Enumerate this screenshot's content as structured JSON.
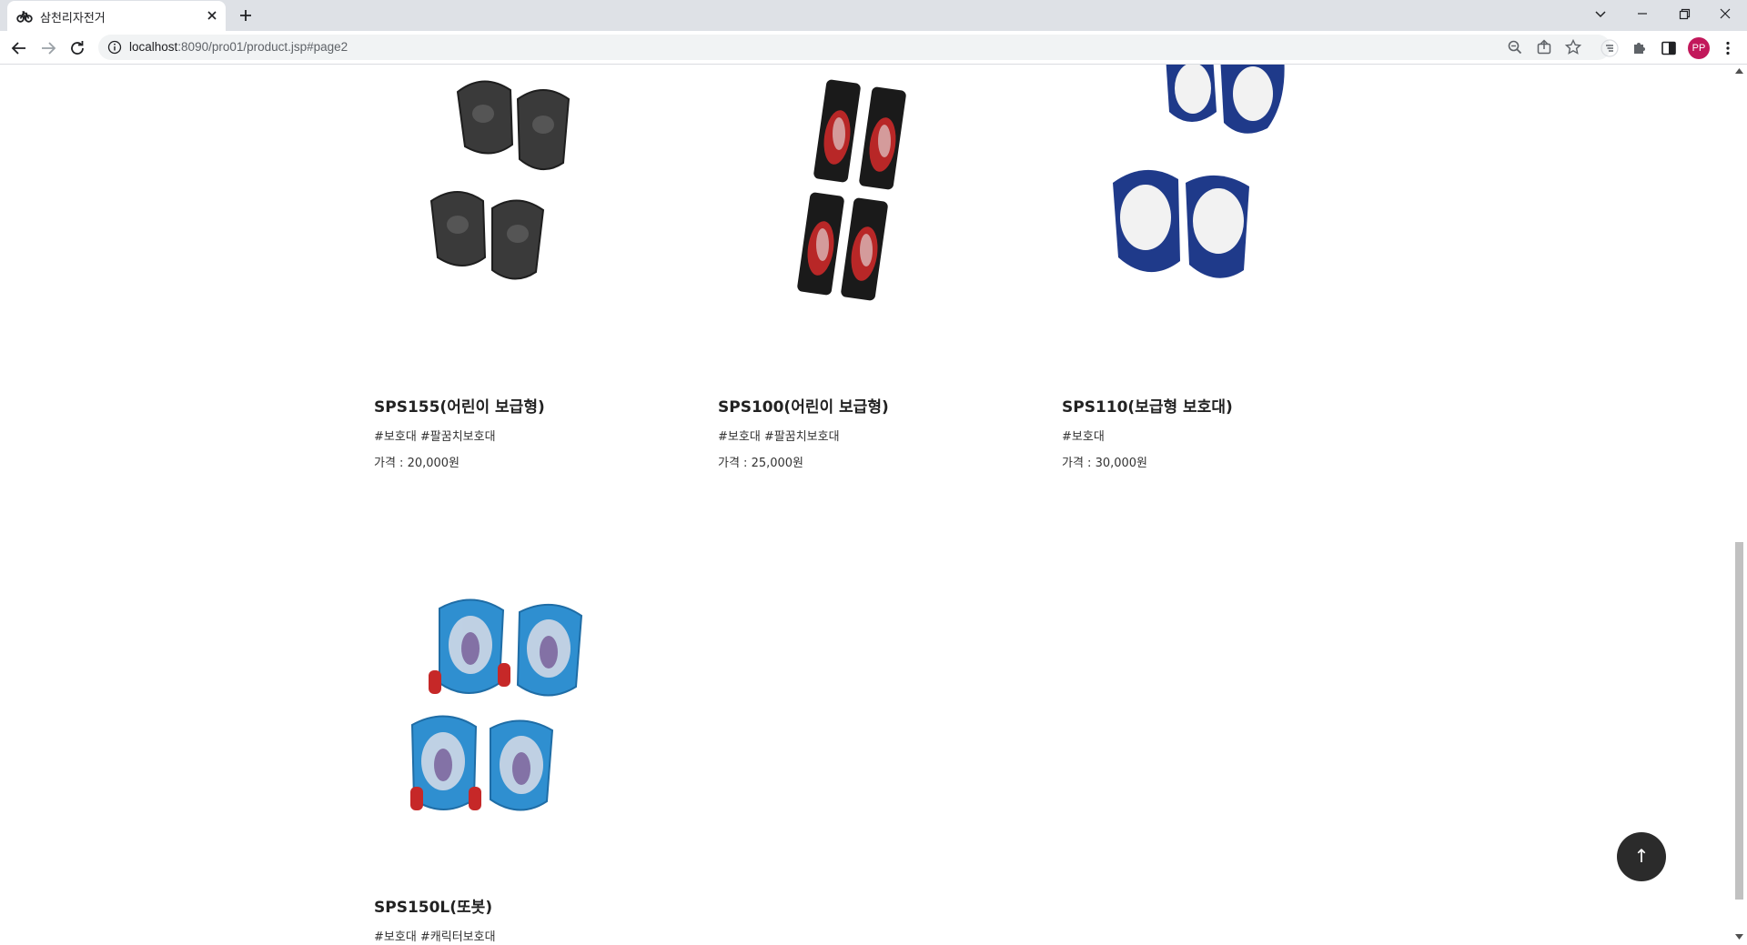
{
  "browser": {
    "tab_title": "삼천리자전거",
    "url_host": "localhost",
    "url_rest": ":8090/pro01/product.jsp#page2",
    "avatar_initials": "PP",
    "accent_color": "#c2185b"
  },
  "products": [
    {
      "name": "SPS155(어린이 보급형)",
      "tags": "#보호대 #팔꿈치보호대",
      "price": "가격 : 20,000원",
      "image_icon": "black-kids-pads-image",
      "colors": [
        "#3a3a3a",
        "#1e1e1e"
      ]
    },
    {
      "name": "SPS100(어린이 보급형)",
      "tags": "#보호대 #팔꿈치보호대",
      "price": "가격 : 25,000원",
      "image_icon": "red-black-pads-package-image",
      "colors": [
        "#d42a2a",
        "#1a1a1a"
      ]
    },
    {
      "name": "SPS110(보급형 보호대)",
      "tags": "#보호대",
      "price": "가격 : 30,000원",
      "image_icon": "navy-white-pads-image",
      "colors": [
        "#1f3a8a",
        "#f2f2f2"
      ]
    },
    {
      "name": "SPS150L(또봇)",
      "tags": "#보호대 #캐릭터보호대",
      "price": "",
      "image_icon": "blue-character-pads-image",
      "colors": [
        "#2f8fd0",
        "#c62828"
      ]
    }
  ],
  "scroll_top_label": "↑"
}
